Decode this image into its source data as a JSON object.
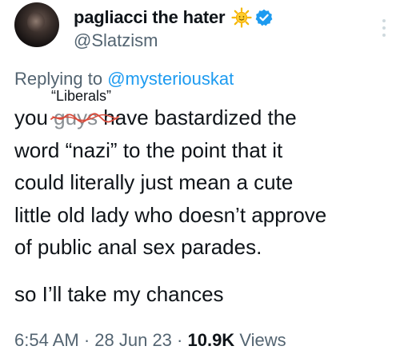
{
  "author": {
    "display_name": "pagliacci the hater",
    "handle": "@Slatzism",
    "badge_emoji": "sun-emoji",
    "verified": true
  },
  "reply": {
    "prefix": "Replying to",
    "user": "@mysteriouskat"
  },
  "annotation": "“Liberals”",
  "tweet": {
    "line1_start": "you ",
    "line1_struck": "guys",
    "line1_end": " have bastardized the",
    "line2": "word “nazi” to the point that it",
    "line3": "could literally just mean a cute",
    "line4": "little old lady who doesn’t approve",
    "line5": "of public anal sex parades.",
    "paragraph2": "so I’ll take my chances"
  },
  "meta": {
    "time": "6:54 AM",
    "sep1": " · ",
    "date": "28 Jun 23",
    "sep2": " · ",
    "views_count": "10.9K",
    "views_label": " Views"
  },
  "colors": {
    "text": "#0f1419",
    "secondary": "#536471",
    "link": "#1d9bf0",
    "verified": "#1d9bf0",
    "scribble": "#d94a3a"
  }
}
